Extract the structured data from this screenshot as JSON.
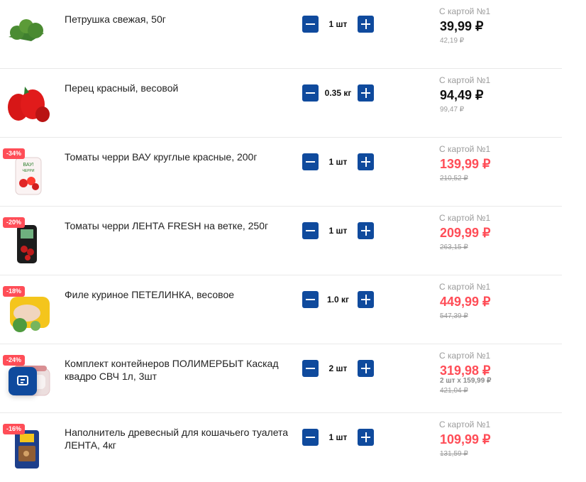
{
  "items": [
    {
      "name": "Петрушка свежая, 50г",
      "qty": "1 шт",
      "card_label": "С картой №1",
      "price": "39,99 ₽",
      "old_price": "42,19 ₽",
      "sale": false,
      "discount": ""
    },
    {
      "name": "Перец красный, весовой",
      "qty": "0.35 кг",
      "card_label": "С картой №1",
      "price": "94,49 ₽",
      "old_price": "99,47 ₽",
      "sale": false,
      "discount": ""
    },
    {
      "name": "Томаты черри ВАУ круглые красные, 200г",
      "qty": "1 шт",
      "card_label": "С картой №1",
      "price": "139,99 ₽",
      "old_price": "210,52 ₽",
      "sale": true,
      "discount": "-34%"
    },
    {
      "name": "Томаты черри ЛЕНТА FRESH на ветке, 250г",
      "qty": "1 шт",
      "card_label": "С картой №1",
      "price": "209,99 ₽",
      "old_price": "263,15 ₽",
      "sale": true,
      "discount": "-20%"
    },
    {
      "name": "Филе куриное ПЕТЕЛИНКА, весовое",
      "qty": "1.0 кг",
      "card_label": "С картой №1",
      "price": "449,99 ₽",
      "old_price": "547,39 ₽",
      "sale": true,
      "discount": "-18%"
    },
    {
      "name": "Комплект контейнеров ПОЛИМЕРБЫТ Каскад квадро СВЧ 1л, 3шт",
      "qty": "2 шт",
      "card_label": "С картой №1",
      "price": "319,98 ₽",
      "subline": "2 шт х 159,99 ₽",
      "old_price": "421,04 ₽",
      "sale": true,
      "discount": "-24%"
    },
    {
      "name": "Наполнитель древесный для кошачьего туалета ЛЕНТА, 4кг",
      "qty": "1 шт",
      "card_label": "С картой №1",
      "price": "109,99 ₽",
      "old_price": "131,59 ₽",
      "sale": true,
      "discount": "-16%"
    }
  ],
  "chat_icon": "chat-icon"
}
